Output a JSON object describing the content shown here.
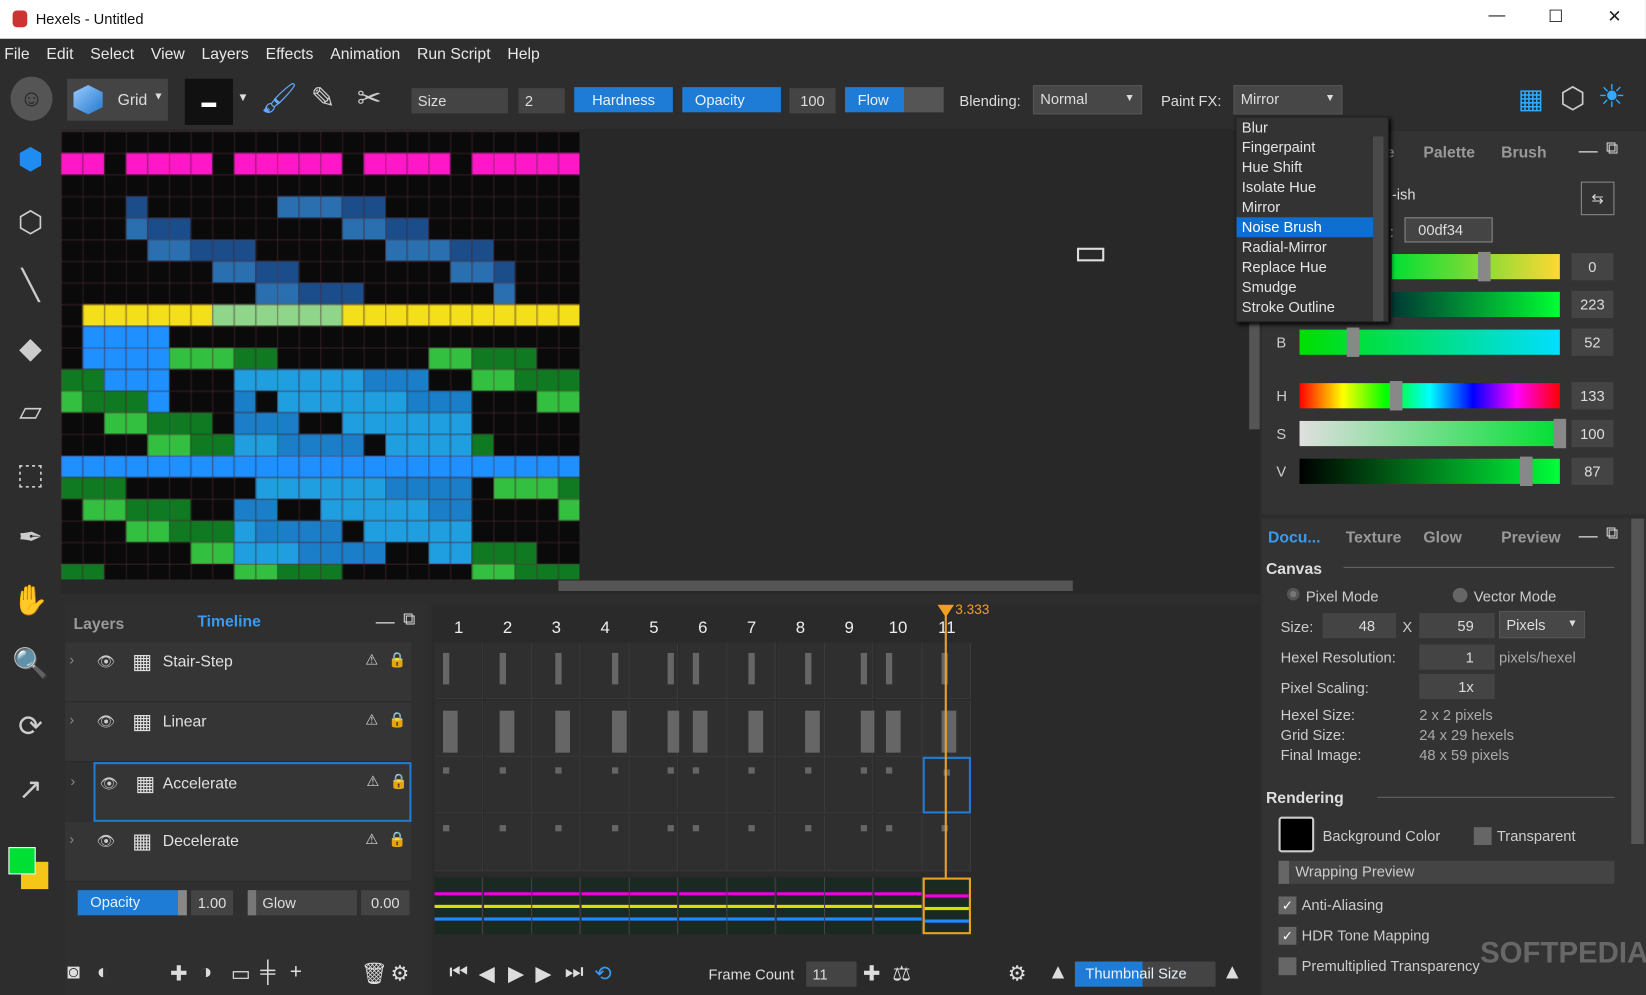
{
  "window": {
    "title": "Hexels - Untitled",
    "minimize": "—",
    "maximize": "☐",
    "close": "✕"
  },
  "menu": [
    "File",
    "Edit",
    "Select",
    "View",
    "Layers",
    "Effects",
    "Animation",
    "Run Script",
    "Help"
  ],
  "toolbar": {
    "grid_label": "Grid",
    "size_label": "Size",
    "size_value": "2",
    "hardness_label": "Hardness",
    "opacity_label": "Opacity",
    "opacity_value": "100",
    "flow_label": "Flow",
    "blending_label": "Blending:",
    "blending_value": "Normal",
    "paintfx_label": "Paint FX:",
    "paintfx_value": "Mirror"
  },
  "paintfx_options": [
    "Blur",
    "Fingerpaint",
    "Hue Shift",
    "Isolate Hue",
    "Mirror",
    "Noise Brush",
    "Radial-Mirror",
    "Replace Hue",
    "Smudge",
    "Stroke Outline"
  ],
  "paintfx_highlighted": "Noise Brush",
  "color_panel": {
    "tabs": [
      "e",
      "Palette",
      "Brush"
    ],
    "color_name": "-ish",
    "hex_label": ":",
    "hex": "00df34",
    "channels": [
      {
        "label": "",
        "value": "0"
      },
      {
        "label": "",
        "value": "223"
      },
      {
        "label": "B",
        "value": "52"
      },
      {
        "label": "H",
        "value": "133"
      },
      {
        "label": "S",
        "value": "100"
      },
      {
        "label": "V",
        "value": "87"
      }
    ],
    "levels": {
      "R": 0,
      "G": 223,
      "B": 52,
      "H": 133,
      "S": 100,
      "V": 87
    }
  },
  "doc_panel": {
    "tabs": [
      "Docu...",
      "Texture",
      "Glow",
      "Preview"
    ],
    "canvas_heading": "Canvas",
    "pixel_mode": "Pixel Mode",
    "vector_mode": "Vector Mode",
    "size_label": "Size:",
    "width": "48",
    "x_label": "X",
    "height": "59",
    "units": "Pixels",
    "hexel_res_label": "Hexel Resolution:",
    "hexel_res": "1",
    "hexel_res_unit": "pixels/hexel",
    "pixel_scaling_label": "Pixel Scaling:",
    "pixel_scaling": "1x",
    "hexel_size_label": "Hexel Size:",
    "hexel_size": "2 x 2 pixels",
    "grid_size_label": "Grid Size:",
    "grid_size": "24 x 29 hexels",
    "final_image_label": "Final Image:",
    "final_image": "48 x 59 pixels",
    "rendering_heading": "Rendering",
    "bg_color_label": "Background Color",
    "transparent_label": "Transparent",
    "wrapping_preview": "Wrapping Preview",
    "anti_aliasing": "Anti-Aliasing",
    "hdr": "HDR Tone Mapping",
    "premultiplied": "Premultiplied Transparency",
    "watermark": "SOFTPEDIA"
  },
  "layers_panel": {
    "tabs": [
      "Layers",
      "Timeline"
    ],
    "layers": [
      "Stair-Step",
      "Linear",
      "Accelerate",
      "Decelerate"
    ],
    "selected": "Accelerate",
    "opacity_label": "Opacity",
    "opacity_value": "1.00",
    "glow_label": "Glow",
    "glow_value": "0.00"
  },
  "timeline": {
    "playhead": "3.333",
    "frames": [
      "1",
      "2",
      "3",
      "4",
      "5",
      "6",
      "7",
      "8",
      "9",
      "10",
      "11"
    ],
    "current_frame": 11,
    "frame_count_label": "Frame Count",
    "frame_count": "11",
    "thumbnail_size_label": "Thumbnail Size"
  },
  "colors": {
    "accent": "#1e7bd6",
    "primary": "#00df34",
    "secondary": "#f5c518",
    "playhead": "#f0a020"
  }
}
